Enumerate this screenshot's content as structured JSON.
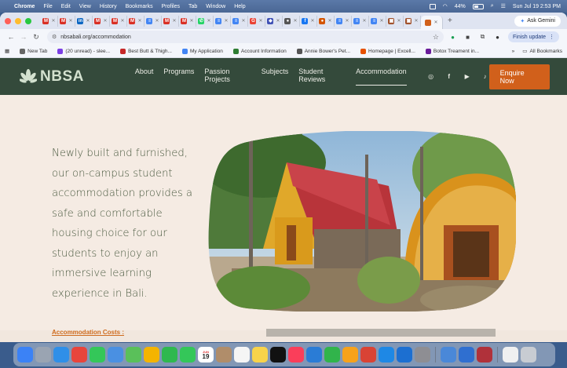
{
  "menubar": {
    "app": "Chrome",
    "items": [
      "File",
      "Edit",
      "View",
      "History",
      "Bookmarks",
      "Profiles",
      "Tab",
      "Window",
      "Help"
    ],
    "battery": "44%",
    "datetime": "Sun Jul 19  2:53 PM"
  },
  "tabs": [
    {
      "icon": "gmail-icon",
      "color": "#d93025",
      "glyph": "M"
    },
    {
      "icon": "gmail-icon",
      "color": "#d93025",
      "glyph": "M"
    },
    {
      "icon": "linkedin-icon",
      "color": "#0a66c2",
      "glyph": "in"
    },
    {
      "icon": "gmail-icon",
      "color": "#d93025",
      "glyph": "M"
    },
    {
      "icon": "gmail-icon",
      "color": "#d93025",
      "glyph": "M"
    },
    {
      "icon": "gmail-icon",
      "color": "#d93025",
      "glyph": "M"
    },
    {
      "icon": "docs-icon",
      "color": "#4285f4",
      "glyph": "≡"
    },
    {
      "icon": "gmail-icon",
      "color": "#d93025",
      "glyph": "M"
    },
    {
      "icon": "gmail-icon",
      "color": "#d93025",
      "glyph": "M"
    },
    {
      "icon": "whatsapp-icon",
      "color": "#25d366",
      "glyph": "✆"
    },
    {
      "icon": "docs-icon",
      "color": "#4285f4",
      "glyph": "≡"
    },
    {
      "icon": "docs-icon",
      "color": "#4285f4",
      "glyph": "≡"
    },
    {
      "icon": "google-icon",
      "color": "#ea4335",
      "glyph": "G"
    },
    {
      "icon": "shield-icon",
      "color": "#3f51b5",
      "glyph": "◆"
    },
    {
      "icon": "circle-icon",
      "color": "#555555",
      "glyph": "●"
    },
    {
      "icon": "facebook-icon",
      "color": "#1877f2",
      "glyph": "f"
    },
    {
      "icon": "circle-icon",
      "color": "#d35400",
      "glyph": "●"
    },
    {
      "icon": "docs-icon",
      "color": "#4285f4",
      "glyph": "≡"
    },
    {
      "icon": "docs-icon",
      "color": "#4285f4",
      "glyph": "≡"
    },
    {
      "icon": "docs-icon",
      "color": "#4285f4",
      "glyph": "≡"
    },
    {
      "icon": "box-icon",
      "color": "#a0522d",
      "glyph": "▣"
    },
    {
      "icon": "box-icon",
      "color": "#a0522d",
      "glyph": "▣"
    }
  ],
  "gemini_label": "Ask Gemini",
  "address": {
    "url": "nbsabali.org/accommodation",
    "update_label": "Finish update"
  },
  "bookmarks": {
    "items": [
      {
        "label": "New Tab",
        "color": "#666666"
      },
      {
        "label": "(20 unread) - slee...",
        "color": "#7b3fe4"
      },
      {
        "label": "Best Butt & Thigh...",
        "color": "#c62828"
      },
      {
        "label": "My Application",
        "color": "#4285f4"
      },
      {
        "label": "Account Information",
        "color": "#2e7d32"
      },
      {
        "label": "Annie Bower's Pet...",
        "color": "#555555"
      },
      {
        "label": "Homepage | Excell...",
        "color": "#e65100"
      },
      {
        "label": "Botox Treament in...",
        "color": "#6a1b9a"
      }
    ],
    "more": "»",
    "all_label": "All Bookmarks"
  },
  "site": {
    "logo_text": "NBSA",
    "nav": [
      "About",
      "Programs",
      "Passion Projects",
      "Subjects",
      "Student Reviews",
      "Accommodation"
    ],
    "active_index": 5,
    "social_icons": [
      "instagram-icon",
      "facebook-icon",
      "youtube-icon",
      "tiktok-icon"
    ],
    "enquire_label": "Enquire Now",
    "accent": "#d1601b",
    "header_bg": "#344a3b"
  },
  "content": {
    "intro": "Newly built and furnished, our on-campus student accommodation provides a safe and comfortable housing choice for our students to enjoy an immersive learning experience in Bali.",
    "cost_label": "Accommodation Costs :"
  },
  "dock": {
    "calendar_month": "JUN",
    "calendar_day": "19",
    "apps": [
      {
        "name": "finder-icon",
        "color": "#3b82f6"
      },
      {
        "name": "launchpad-icon",
        "color": "#9aa4b2"
      },
      {
        "name": "safari-icon",
        "color": "#2f8fe8"
      },
      {
        "name": "chrome-icon",
        "color": "#e8453c"
      },
      {
        "name": "messages-icon",
        "color": "#34c759"
      },
      {
        "name": "mail-icon",
        "color": "#4a90e2"
      },
      {
        "name": "maps-icon",
        "color": "#5ac05a"
      },
      {
        "name": "photos-icon",
        "color": "#f4b400"
      },
      {
        "name": "facetime-icon",
        "color": "#2fb84f"
      },
      {
        "name": "phone-icon",
        "color": "#34c759"
      },
      {
        "name": "calendar-icon",
        "color": "#ffffff"
      },
      {
        "name": "contacts-icon",
        "color": "#b08d6a"
      },
      {
        "name": "reminders-icon",
        "color": "#f5f5f5"
      },
      {
        "name": "notes-icon",
        "color": "#f8d34a"
      },
      {
        "name": "apple-tv-icon",
        "color": "#111111"
      },
      {
        "name": "music-icon",
        "color": "#fa3e5a"
      },
      {
        "name": "keynote-icon",
        "color": "#2a7cd6"
      },
      {
        "name": "numbers-icon",
        "color": "#31b44b"
      },
      {
        "name": "pages-icon",
        "color": "#f7a21b"
      },
      {
        "name": "rocket-icon",
        "color": "#d94335"
      },
      {
        "name": "app-store-icon",
        "color": "#1e88e5"
      },
      {
        "name": "xcode-icon",
        "color": "#1c6fd1"
      },
      {
        "name": "system-settings-icon",
        "color": "#8e8e93"
      },
      {
        "name": "preview-icon",
        "color": "#4a88d8"
      },
      {
        "name": "quicktime-icon",
        "color": "#2f6fd0"
      },
      {
        "name": "dictionary-icon",
        "color": "#b0313a"
      },
      {
        "name": "document-icon",
        "color": "#f0f0f0"
      },
      {
        "name": "trash-icon",
        "color": "#c8ccd2"
      }
    ]
  }
}
